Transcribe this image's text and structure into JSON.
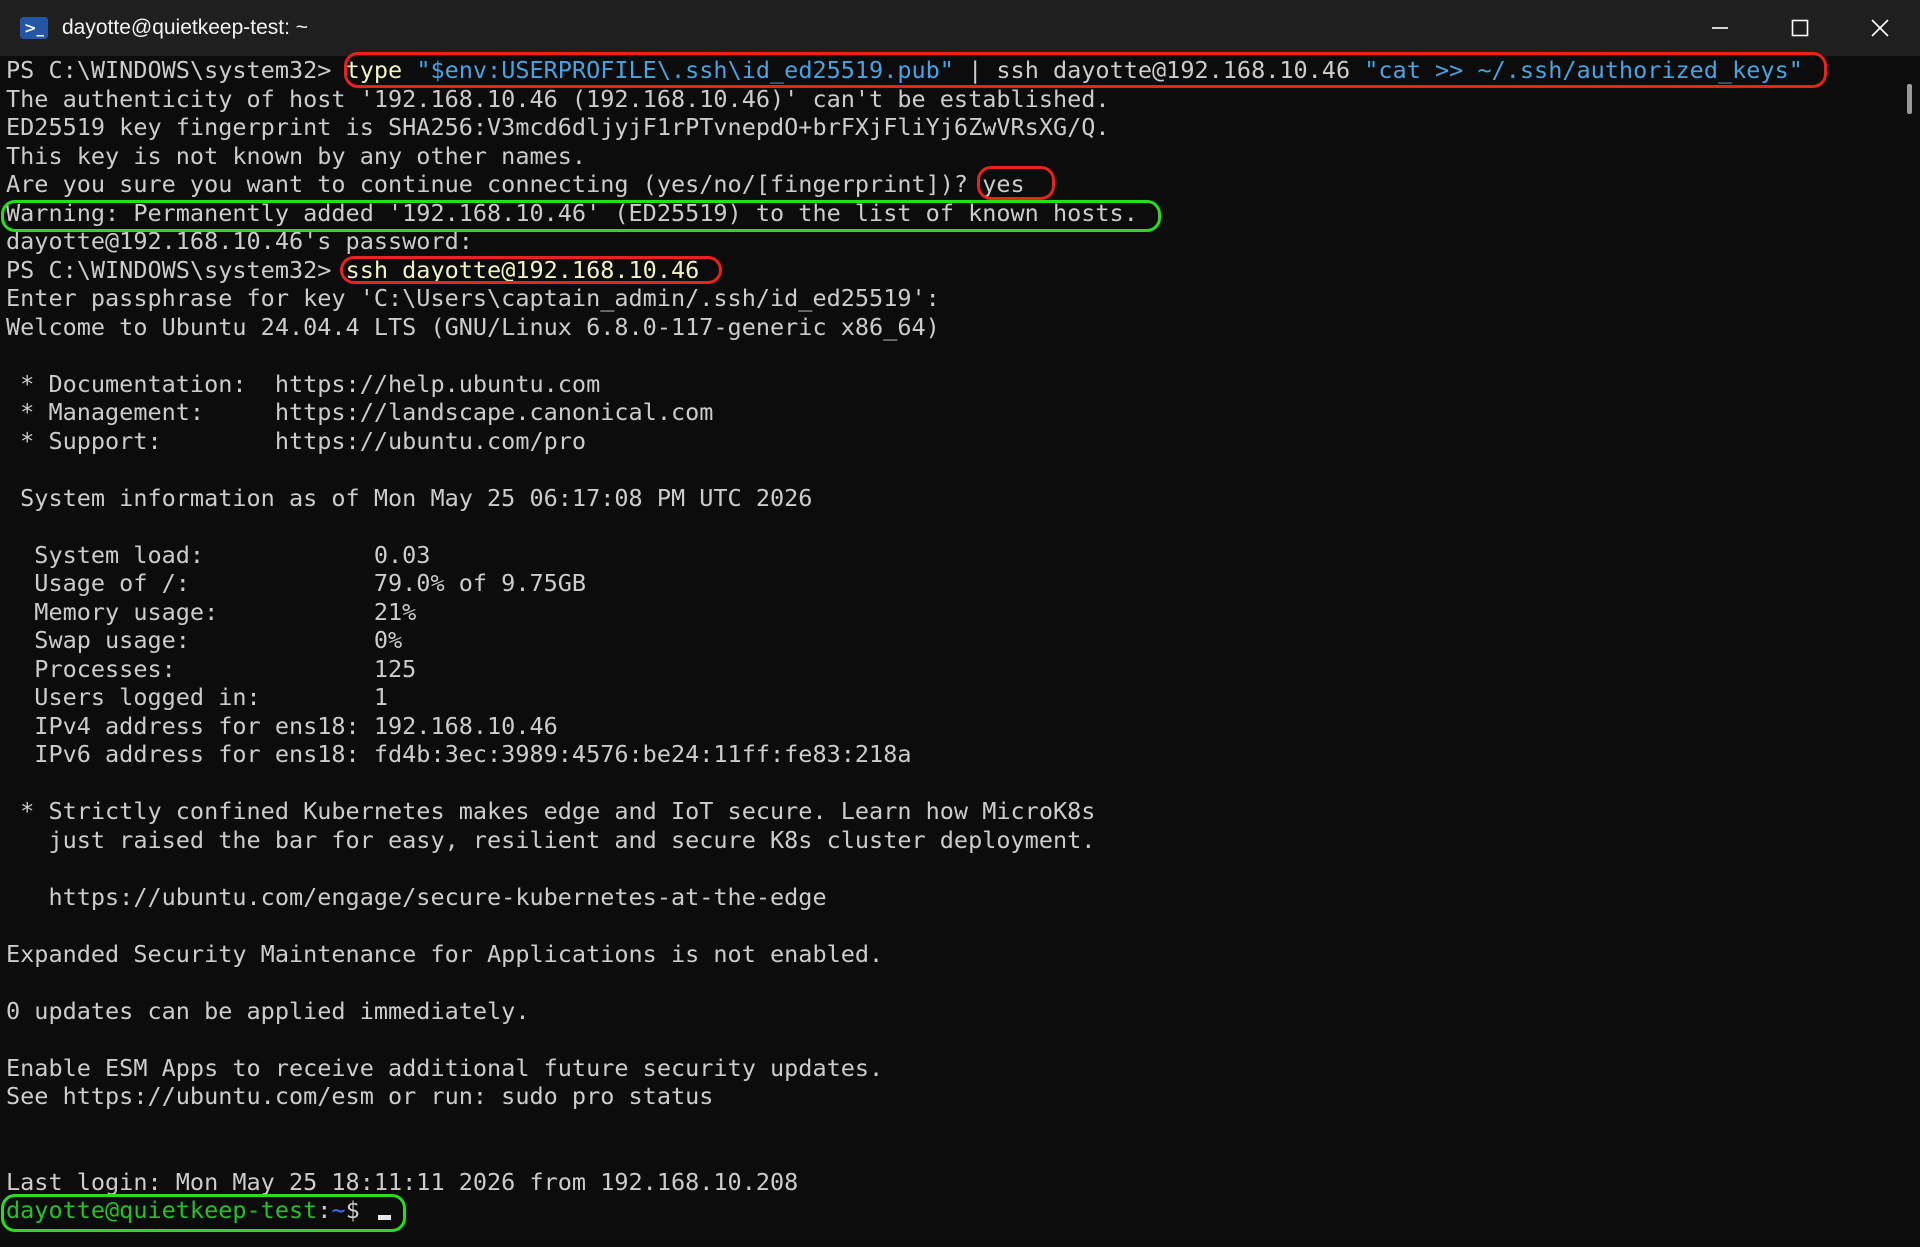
{
  "window": {
    "title": "dayotte@quietkeep-test: ~",
    "icon": "powershell-icon",
    "controls": [
      "minimize-icon",
      "maximize-icon",
      "close-icon"
    ]
  },
  "terminal": {
    "prompt_ps": "PS C:\\WINDOWS\\system32> ",
    "cmd1": {
      "kw": "type",
      "arg": "\"$env:USERPROFILE\\.ssh\\id_ed25519.pub\"",
      "mid": " | ssh dayotte@192.168.10.46 ",
      "remote": "\"cat >> ~/.ssh/authorized_keys\""
    },
    "auth_line": "The authenticity of host '192.168.10.46 (192.168.10.46)' can't be established.",
    "fingerprint_line": "ED25519 key fingerprint is SHA256:V3mcd6dljyjF1rPTvnepdO+brFXjFliYj6ZwVRsXG/Q.",
    "unknown_key_line": "This key is not known by any other names.",
    "continue_prompt": "Are you sure you want to continue connecting (yes/no/[fingerprint])? ",
    "continue_answer": "yes",
    "warning_line": "Warning: Permanently added '192.168.10.46' (ED25519) to the list of known hosts.",
    "password_prompt": "dayotte@192.168.10.46's password:",
    "cmd2": "ssh dayotte@192.168.10.46",
    "passphrase_prompt": "Enter passphrase for key 'C:\\Users\\captain_admin/.ssh/id_ed25519':",
    "welcome": "Welcome to Ubuntu 24.04.4 LTS (GNU/Linux 6.8.0-117-generic x86_64)",
    "links": [
      " * Documentation:  https://help.ubuntu.com",
      " * Management:     https://landscape.canonical.com",
      " * Support:        https://ubuntu.com/pro"
    ],
    "sysinfo_header": " System information as of Mon May 25 06:17:08 PM UTC 2026",
    "sysinfo": [
      "  System load:            0.03",
      "  Usage of /:             79.0% of 9.75GB",
      "  Memory usage:           21%",
      "  Swap usage:             0%",
      "  Processes:              125",
      "  Users logged in:        1",
      "  IPv4 address for ens18: 192.168.10.46",
      "  IPv6 address for ens18: fd4b:3ec:3989:4576:be24:11ff:fe83:218a"
    ],
    "k8s_1": " * Strictly confined Kubernetes makes edge and IoT secure. Learn how MicroK8s",
    "k8s_2": "   just raised the bar for easy, resilient and secure K8s cluster deployment.",
    "k8s_url": "   https://ubuntu.com/engage/secure-kubernetes-at-the-edge",
    "esm_line": "Expanded Security Maintenance for Applications is not enabled.",
    "updates_line": "0 updates can be applied immediately.",
    "esm_enable": "Enable ESM Apps to receive additional future security updates.",
    "esm_see": "See https://ubuntu.com/esm or run: sudo pro status",
    "last_login": "Last login: Mon May 25 18:11:11 2026 from 192.168.10.208",
    "final_prompt_user": "dayotte@quietkeep-test",
    "final_prompt_sep": ":",
    "final_prompt_path": "~",
    "final_prompt_end": "$ "
  },
  "colors": {
    "background": "#0c0c0c",
    "text": "#cccccc",
    "string": "#4aa3e0",
    "prompt_user": "#25c02a",
    "prompt_path": "#3b6fff",
    "annotation_red": "#e8231c",
    "annotation_green": "#28dc1e"
  }
}
